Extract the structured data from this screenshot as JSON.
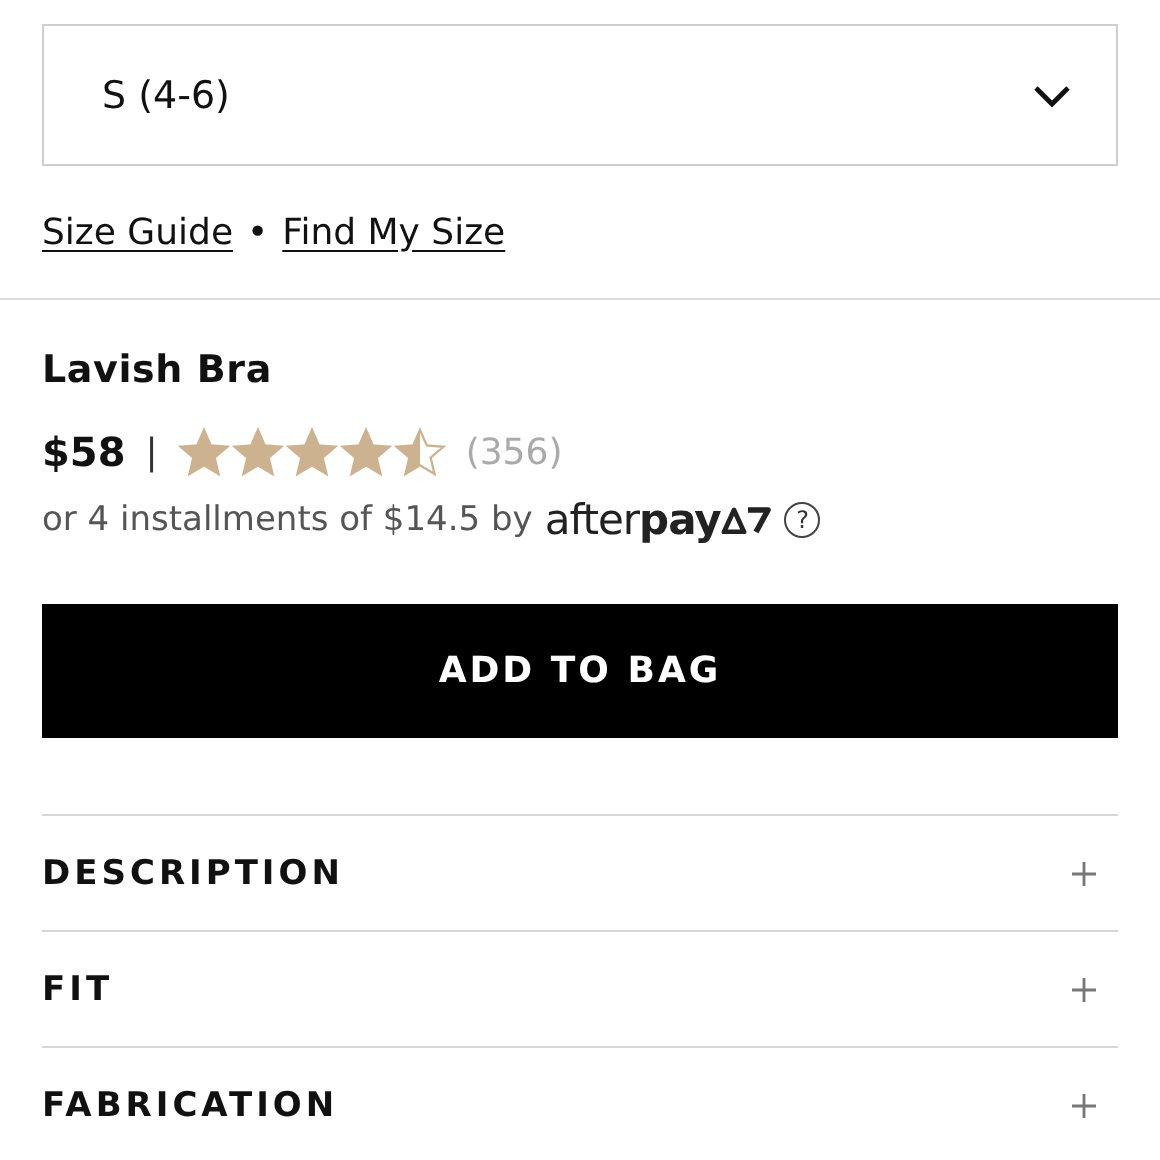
{
  "size_select": {
    "value": "S (4-6)"
  },
  "size_links": [
    {
      "label": "Size Guide"
    },
    {
      "label": "Find My Size"
    }
  ],
  "link_separator": "•",
  "product": {
    "name": "Lavish Bra",
    "price": "$58",
    "price_separator": "|",
    "stars": 4.5,
    "review_count": "(356)"
  },
  "installments": {
    "text": "or 4 installments of $14.5 by",
    "provider": "after**pay**",
    "help": "?"
  },
  "add_button": "ADD TO BAG",
  "sections": [
    {
      "label": "DESCRIPTION",
      "expanded": false
    },
    {
      "label": "FIT",
      "expanded": false
    },
    {
      "label": "FABRICATION",
      "expanded": false
    }
  ]
}
